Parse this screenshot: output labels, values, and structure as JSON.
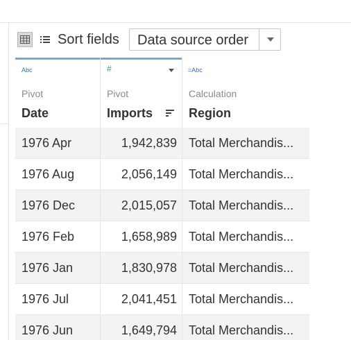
{
  "toolbar": {
    "sort_label": "Sort fields",
    "sort_value": "Data source order"
  },
  "columns": [
    {
      "type_icon": "Abc",
      "origin": "Pivot",
      "name": "Date"
    },
    {
      "type_icon": "#",
      "origin": "Pivot",
      "name": "Imports"
    },
    {
      "type_icon": "=Abc",
      "origin": "Calculation",
      "name": "Region"
    }
  ],
  "rows": [
    {
      "date": "1976 Apr",
      "imports": "1,942,839",
      "region": "Total Merchandis..."
    },
    {
      "date": "1976 Aug",
      "imports": "2,056,149",
      "region": "Total Merchandis..."
    },
    {
      "date": "1976 Dec",
      "imports": "2,015,057",
      "region": "Total Merchandis..."
    },
    {
      "date": "1976 Feb",
      "imports": "1,658,989",
      "region": "Total Merchandis..."
    },
    {
      "date": "1976 Jan",
      "imports": "1,830,978",
      "region": "Total Merchandis..."
    },
    {
      "date": "1976 Jul",
      "imports": "2,041,451",
      "region": "Total Merchandis..."
    },
    {
      "date": "1976 Jun",
      "imports": "1,649,794",
      "region": "Total Merchandis..."
    }
  ]
}
